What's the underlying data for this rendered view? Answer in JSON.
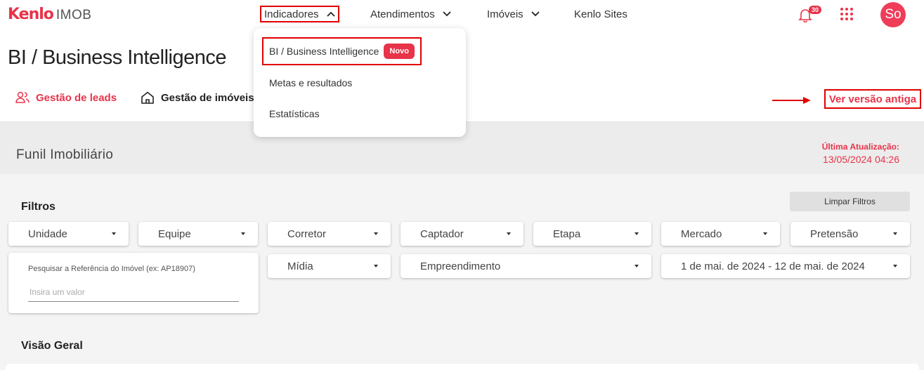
{
  "header": {
    "logo_brand": "Kenlo",
    "logo_product": "IMOB",
    "nav": {
      "indicadores": "Indicadores",
      "atendimentos": "Atendimentos",
      "imoveis": "Imóveis",
      "sites": "Kenlo Sites"
    },
    "notifications_count": "30",
    "avatar_initials": "So"
  },
  "dropdown": {
    "items": [
      {
        "label": "BI / Business Intelligence",
        "badge": "Novo"
      },
      {
        "label": "Metas e resultados"
      },
      {
        "label": "Estatísticas"
      }
    ]
  },
  "page": {
    "title": "BI / Business Intelligence",
    "tabs": [
      {
        "label": "Gestão de leads",
        "active": true,
        "icon": "users-icon"
      },
      {
        "label": "Gestão de imóveis",
        "active": false,
        "icon": "home-icon"
      }
    ],
    "old_version_link": "Ver versão antiga"
  },
  "funnel": {
    "title": "Funil Imobiliário",
    "last_update_label": "Última Atualização:",
    "last_update_value": "13/05/2024 04:26"
  },
  "filters": {
    "title": "Filtros",
    "clear_label": "Limpar Filtros",
    "selects": {
      "unidade": "Unidade",
      "equipe": "Equipe",
      "corretor": "Corretor",
      "captador": "Captador",
      "etapa": "Etapa",
      "mercado": "Mercado",
      "pretensao": "Pretensão",
      "midia": "Mídia",
      "empreendimento": "Empreendimento",
      "periodo": "1 de mai. de 2024 - 12 de mai. de 2024"
    },
    "search": {
      "label": "Pesquisar a Referência do Imóvel (ex: AP18907)",
      "placeholder": "Insira um valor",
      "value": ""
    }
  },
  "overview": {
    "title": "Visão Geral"
  },
  "colors": {
    "accent": "#e8334a",
    "highlight_border": "#e00000",
    "body_bg": "#f4f4f4"
  }
}
